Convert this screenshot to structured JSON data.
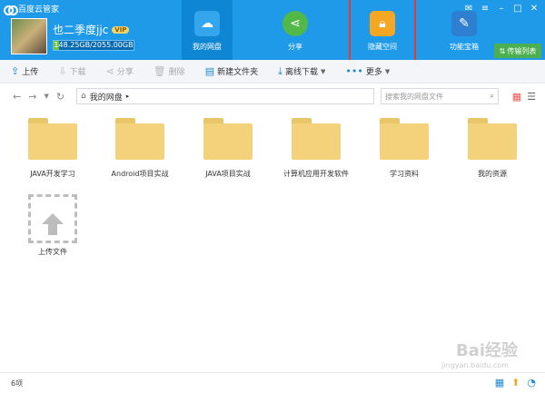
{
  "app": {
    "title": "百度云管家"
  },
  "user": {
    "name": "也二季度jjc",
    "vip": "VIP",
    "quota_text": "148.25GB/2055.00GB",
    "quota_fraction": 0.072
  },
  "nav": [
    {
      "label": "我的网盘",
      "icon": "cloud-icon",
      "color": "#33a6ee",
      "active": true
    },
    {
      "label": "分享",
      "icon": "share-icon",
      "color": "#52b848",
      "active": false
    },
    {
      "label": "隐藏空间",
      "icon": "lock-icon",
      "color": "#f5a623",
      "active": false,
      "highlighted": true
    },
    {
      "label": "功能宝箱",
      "icon": "wrench-icon",
      "color": "#2f7fd1",
      "active": false
    }
  ],
  "transfer_button": "传输列表",
  "toolbar": {
    "upload": "上传",
    "download": "下载",
    "share": "分享",
    "delete": "删除",
    "new_folder": "新建文件夹",
    "offline_download": "离线下载",
    "more": "更多"
  },
  "path": {
    "root": "我的网盘"
  },
  "search": {
    "placeholder": "搜索我的网盘文件"
  },
  "files": [
    {
      "name": "JAVA开发学习"
    },
    {
      "name": "Android项目实战"
    },
    {
      "name": "JAVA项目实战"
    },
    {
      "name": "计算机应用开发软件"
    },
    {
      "name": "学习资料"
    },
    {
      "name": "我的资源"
    }
  ],
  "upload_tile": {
    "name": "上传文件"
  },
  "status": {
    "count": "6项"
  },
  "watermark": {
    "text": "Bai经验",
    "sub": "jingyan.baidu.com"
  }
}
